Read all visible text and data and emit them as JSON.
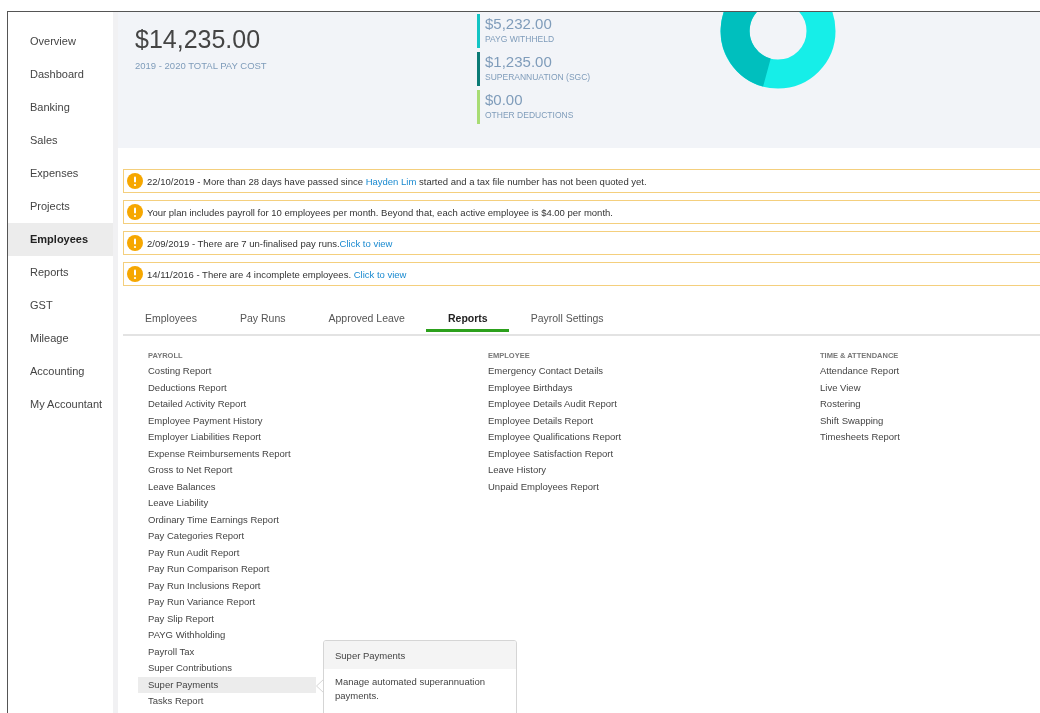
{
  "sidebar": {
    "items": [
      {
        "label": "Overview",
        "selected": false
      },
      {
        "label": "Dashboard",
        "selected": false
      },
      {
        "label": "Banking",
        "selected": false
      },
      {
        "label": "Sales",
        "selected": false
      },
      {
        "label": "Expenses",
        "selected": false
      },
      {
        "label": "Projects",
        "selected": false
      },
      {
        "label": "Employees",
        "selected": true
      },
      {
        "label": "Reports",
        "selected": false
      },
      {
        "label": "GST",
        "selected": false
      },
      {
        "label": "Mileage",
        "selected": false
      },
      {
        "label": "Accounting",
        "selected": false
      },
      {
        "label": "My Accountant",
        "selected": false
      }
    ]
  },
  "summary": {
    "total": {
      "amount": "$14,235.00",
      "label": "2019 - 2020 TOTAL PAY COST"
    },
    "breakdown": [
      {
        "amount": "$5,232.00",
        "label": "PAYG WITHHELD",
        "color": "#13c4c4"
      },
      {
        "amount": "$1,235.00",
        "label": "SUPERANNUATION (SGC)",
        "color": "#0b7a75"
      },
      {
        "amount": "$0.00",
        "label": "OTHER DEDUCTIONS",
        "color": "#a8dc74"
      }
    ]
  },
  "alerts": [
    {
      "segments": [
        {
          "kind": "text",
          "text": "22/10/2019 - More than 28 days have passed since "
        },
        {
          "kind": "link",
          "text": "Hayden Lim"
        },
        {
          "kind": "text",
          "text": " started and a tax file number has not been quoted yet."
        }
      ]
    },
    {
      "segments": [
        {
          "kind": "text",
          "text": "Your plan includes payroll for 10 employees per month. Beyond that, each active employee is $4.00 per month."
        }
      ]
    },
    {
      "segments": [
        {
          "kind": "text",
          "text": "2/09/2019 - There are 7 un-finalised pay runs."
        },
        {
          "kind": "link",
          "text": "Click to view"
        }
      ]
    },
    {
      "segments": [
        {
          "kind": "text",
          "text": "14/11/2016 - There are 4 incomplete employees. "
        },
        {
          "kind": "link",
          "text": "Click to view"
        }
      ]
    }
  ],
  "tabs": [
    {
      "label": "Employees",
      "selected": false
    },
    {
      "label": "Pay Runs",
      "selected": false
    },
    {
      "label": "Approved Leave",
      "selected": false
    },
    {
      "label": "Reports",
      "selected": true
    },
    {
      "label": "Payroll Settings",
      "selected": false
    }
  ],
  "report_columns": [
    {
      "heading": "PAYROLL",
      "items": [
        {
          "label": "Costing Report",
          "hovered": false
        },
        {
          "label": "Deductions Report",
          "hovered": false
        },
        {
          "label": "Detailed Activity Report",
          "hovered": false
        },
        {
          "label": "Employee Payment History",
          "hovered": false
        },
        {
          "label": "Employer Liabilities Report",
          "hovered": false
        },
        {
          "label": "Expense Reimbursements Report",
          "hovered": false
        },
        {
          "label": "Gross to Net Report",
          "hovered": false
        },
        {
          "label": "Leave Balances",
          "hovered": false
        },
        {
          "label": "Leave Liability",
          "hovered": false
        },
        {
          "label": "Ordinary Time Earnings Report",
          "hovered": false
        },
        {
          "label": "Pay Categories Report",
          "hovered": false
        },
        {
          "label": "Pay Run Audit Report",
          "hovered": false
        },
        {
          "label": "Pay Run Comparison Report",
          "hovered": false
        },
        {
          "label": "Pay Run Inclusions Report",
          "hovered": false
        },
        {
          "label": "Pay Run Variance Report",
          "hovered": false
        },
        {
          "label": "Pay Slip Report",
          "hovered": false
        },
        {
          "label": "PAYG Withholding",
          "hovered": false
        },
        {
          "label": "Payroll Tax",
          "hovered": false
        },
        {
          "label": "Super Contributions",
          "hovered": false
        },
        {
          "label": "Super Payments",
          "hovered": true
        },
        {
          "label": "Tasks Report",
          "hovered": false
        }
      ]
    },
    {
      "heading": "EMPLOYEE",
      "items": [
        {
          "label": "Emergency Contact Details",
          "hovered": false
        },
        {
          "label": "Employee Birthdays",
          "hovered": false
        },
        {
          "label": "Employee Details Audit Report",
          "hovered": false
        },
        {
          "label": "Employee Details Report",
          "hovered": false
        },
        {
          "label": "Employee Qualifications Report",
          "hovered": false
        },
        {
          "label": "Employee Satisfaction Report",
          "hovered": false
        },
        {
          "label": "Leave History",
          "hovered": false
        },
        {
          "label": "Unpaid Employees Report",
          "hovered": false
        }
      ]
    },
    {
      "heading": "TIME & ATTENDANCE",
      "items": [
        {
          "label": "Attendance Report",
          "hovered": false
        },
        {
          "label": "Live View",
          "hovered": false
        },
        {
          "label": "Rostering",
          "hovered": false
        },
        {
          "label": "Shift Swapping",
          "hovered": false
        },
        {
          "label": "Timesheets Report",
          "hovered": false
        }
      ]
    }
  ],
  "tooltip": {
    "title": "Super Payments",
    "text": "Manage automated superannuation payments."
  }
}
